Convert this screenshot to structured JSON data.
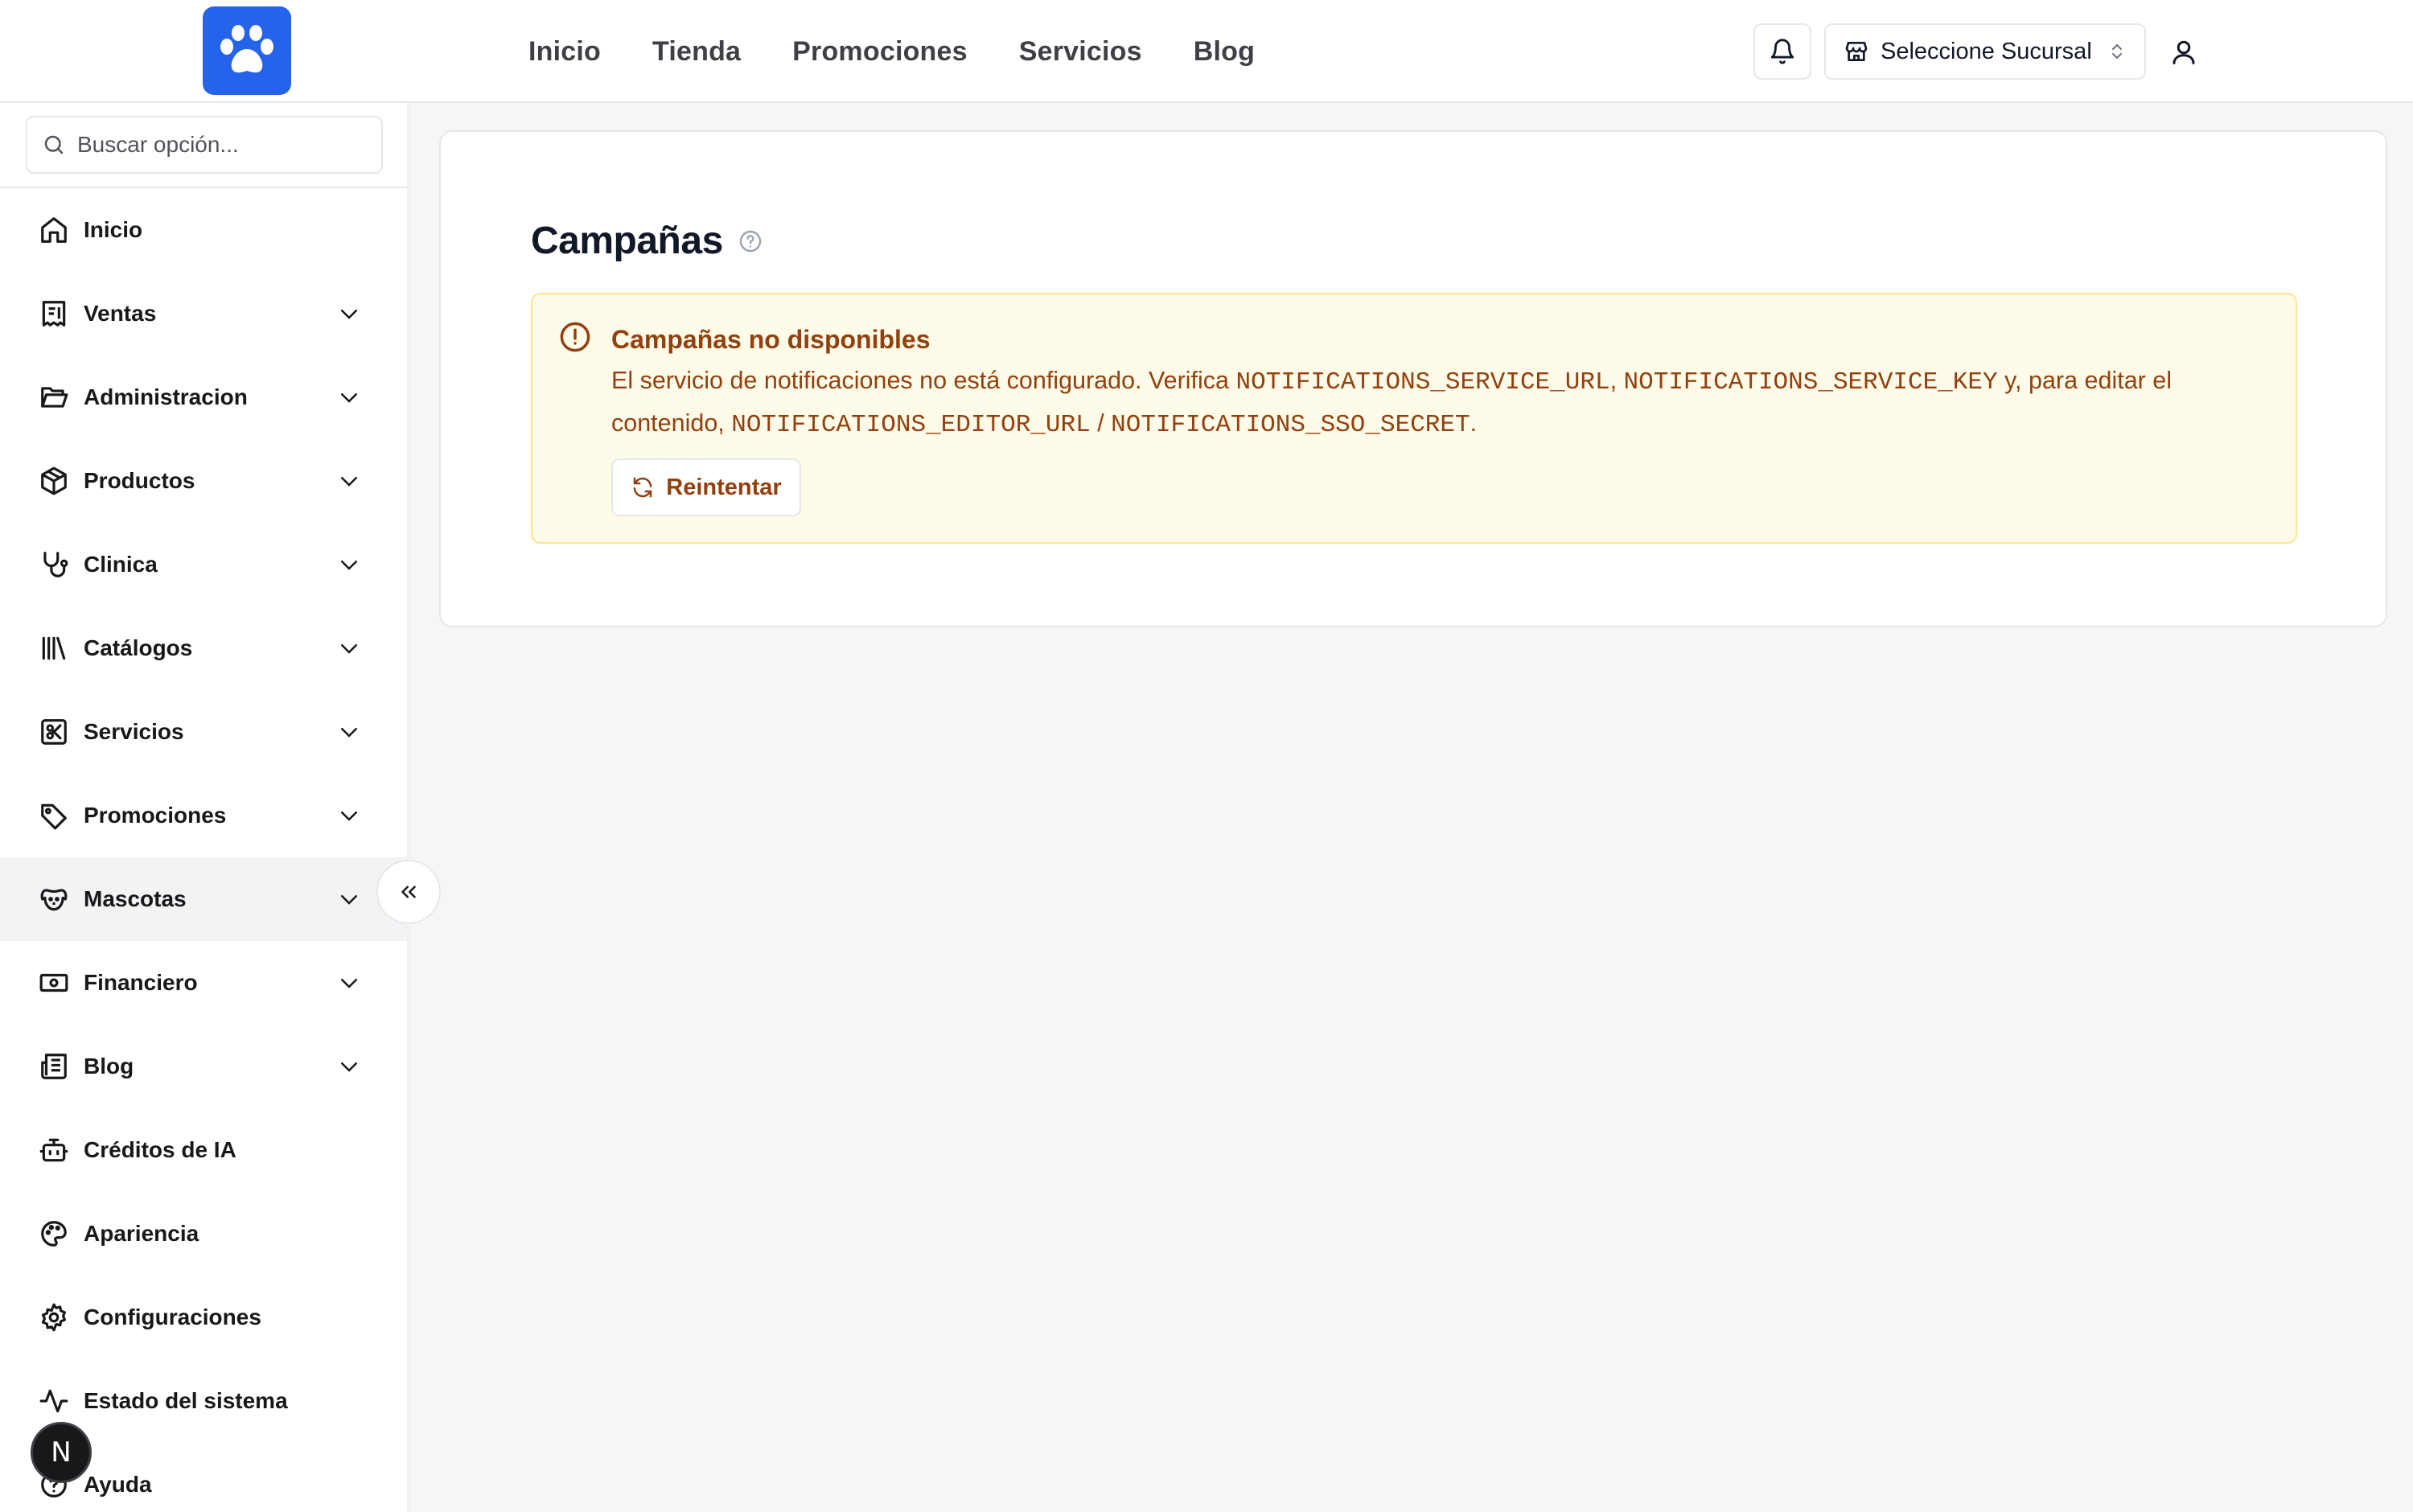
{
  "header": {
    "nav": [
      "Inicio",
      "Tienda",
      "Promociones",
      "Servicios",
      "Blog"
    ],
    "branch_select_label": "Seleccione Sucursal"
  },
  "sidebar": {
    "search_placeholder": "Buscar opción...",
    "items": [
      {
        "label": "Inicio",
        "icon": "home-icon",
        "expandable": false
      },
      {
        "label": "Ventas",
        "icon": "receipt-icon",
        "expandable": true
      },
      {
        "label": "Administracion",
        "icon": "folder-open-icon",
        "expandable": true
      },
      {
        "label": "Productos",
        "icon": "package-icon",
        "expandable": true
      },
      {
        "label": "Clinica",
        "icon": "stethoscope-icon",
        "expandable": true
      },
      {
        "label": "Catálogos",
        "icon": "library-icon",
        "expandable": true
      },
      {
        "label": "Servicios",
        "icon": "scissors-square-icon",
        "expandable": true
      },
      {
        "label": "Promociones",
        "icon": "tag-icon",
        "expandable": true
      },
      {
        "label": "Mascotas",
        "icon": "dog-icon",
        "expandable": true,
        "active": true
      },
      {
        "label": "Financiero",
        "icon": "banknote-icon",
        "expandable": true
      },
      {
        "label": "Blog",
        "icon": "newspaper-icon",
        "expandable": true
      },
      {
        "label": "Créditos de IA",
        "icon": "bot-icon",
        "expandable": false
      },
      {
        "label": "Apariencia",
        "icon": "palette-icon",
        "expandable": false
      },
      {
        "label": "Configuraciones",
        "icon": "gear-icon",
        "expandable": false
      },
      {
        "label": "Estado del sistema",
        "icon": "activity-icon",
        "expandable": false
      },
      {
        "label": "Ayuda",
        "icon": "help-circle-icon",
        "expandable": false
      }
    ],
    "badge_letter": "N"
  },
  "main": {
    "title": "Campañas",
    "alert": {
      "title": "Campañas no disponibles",
      "text_1": "El servicio de notificaciones no está configurado. Verifica ",
      "code_1": "NOTIFICATIONS_SERVICE_URL",
      "text_2": ", ",
      "code_2": "NOTIFICATIONS_SERVICE_KEY",
      "text_3": " y, para editar el contenido, ",
      "code_3": "NOTIFICATIONS_EDITOR_URL",
      "text_4": " / ",
      "code_4": "NOTIFICATIONS_SSO_SECRET",
      "text_5": ".",
      "retry_label": "Reintentar"
    }
  },
  "colors": {
    "brand": "#2563eb",
    "alert_bg": "#fefbe9",
    "alert_border": "#fce58a",
    "alert_text": "#92400e"
  }
}
